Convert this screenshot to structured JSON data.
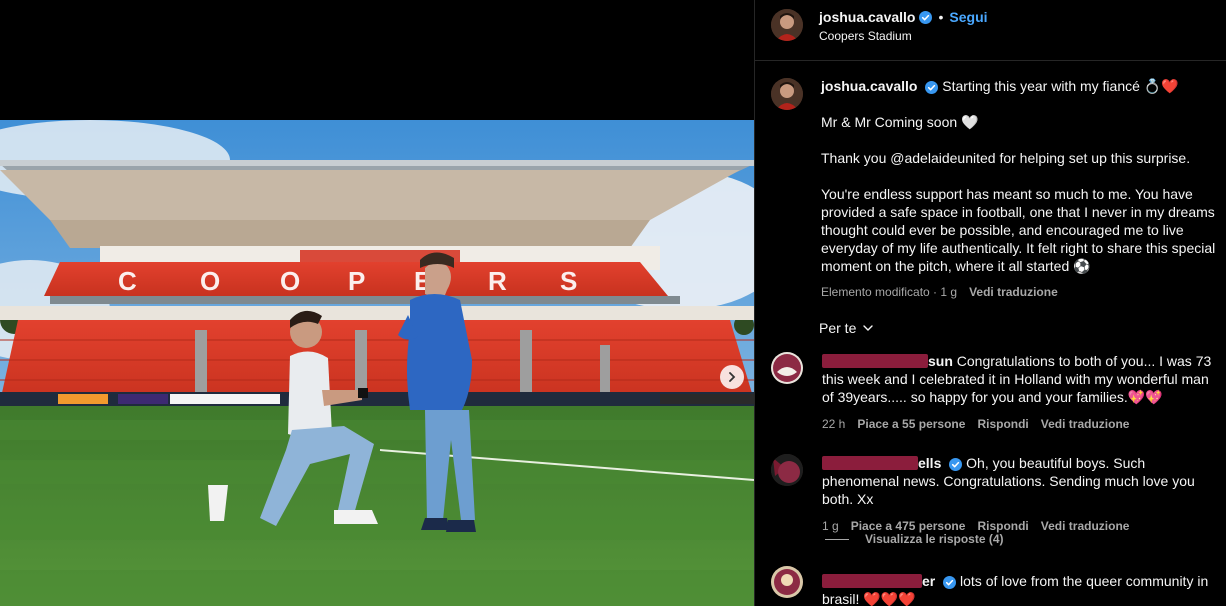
{
  "post": {
    "username": "joshua.cavallo",
    "follow_label": "Segui",
    "separator": "•",
    "location": "Coopers Stadium"
  },
  "caption": {
    "username": "joshua.cavallo",
    "line1": "Starting this year with my fiancé 💍❤️",
    "line2": "Mr & Mr Coming soon 🤍",
    "line3": "Thank you @adelaideunited for helping set up this surprise.",
    "line4": "You're endless support has meant so much to me. You have provided a safe space in football, one that I never in my dreams thought could ever be possible, and encouraged me to live everyday of my life authentically. It felt right to share this special moment on the pitch, where it all started ⚽",
    "edited": "Elemento modificato · 1 g",
    "translate": "Vedi traduzione"
  },
  "filter": {
    "label": "Per te"
  },
  "comments": [
    {
      "username_suffix": "sun",
      "text": "Congratulations to both of you... I was 73 this week and I celebrated it in Holland with my wonderful man of 39years..... so happy for you and your families.💖💖",
      "time": "22 h",
      "likes": "Piace a 55 persone",
      "reply": "Rispondi",
      "translate": "Vedi traduzione"
    },
    {
      "username_suffix": "ells",
      "text": "Oh, you beautiful boys. Such phenomenal news. Congratulations. Sending much love you both. Xx",
      "time": "1 g",
      "likes": "Piace a 475 persone",
      "reply": "Rispondi",
      "translate": "Vedi traduzione"
    },
    {
      "username_suffix": "er",
      "text": "lots of love from the queer community in brasil! ❤️❤️❤️"
    }
  ],
  "replies": {
    "label": "Visualizza le risposte (4)"
  },
  "colors": {
    "accent": "#4aa8ff",
    "verified": "#3897f0",
    "muted": "#a8a8a8",
    "background": "#000000"
  },
  "icons": [
    "verified-badge-icon",
    "chevron-down-icon",
    "heart-icon",
    "chevron-right-icon"
  ]
}
